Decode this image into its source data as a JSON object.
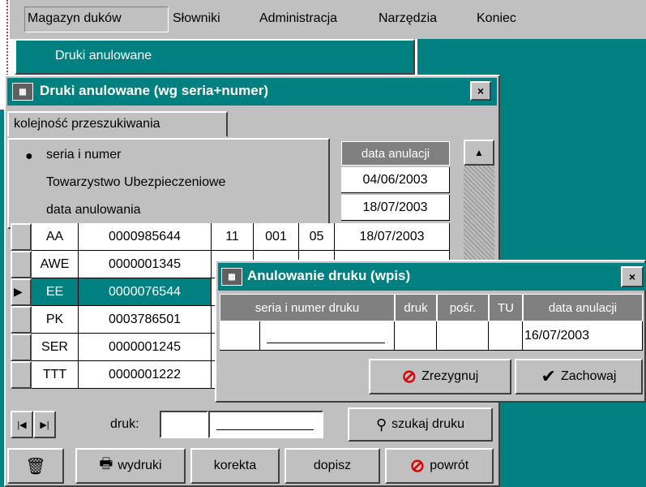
{
  "menu": {
    "items": [
      {
        "label": "Magazyn duków"
      },
      {
        "label": "Słowniki"
      },
      {
        "label": "Administracja"
      },
      {
        "label": "Narzędzia"
      },
      {
        "label": "Koniec"
      }
    ],
    "submenu_item": "Druki anulowane"
  },
  "main_window": {
    "title": "Druki anulowane (wg seria+numer)",
    "close": "×",
    "tab_label": "kolejność przeszukiwania",
    "sort_options": [
      {
        "label": "seria i numer",
        "selected": true
      },
      {
        "label": "Towarzystwo Ubezpieczeniowe",
        "selected": false
      },
      {
        "label": "data anulowania",
        "selected": false
      }
    ],
    "date_header": "data anulacji",
    "top_dates": [
      "04/06/2003",
      "18/07/2003"
    ],
    "rows": [
      {
        "seria": "AA",
        "numer": "0000985644",
        "c1": "11",
        "c2": "001",
        "c3": "05",
        "date": "18/07/2003",
        "current": false
      },
      {
        "seria": "AWE",
        "numer": "0000001345",
        "c1": "",
        "c2": "",
        "c3": "",
        "date": "",
        "current": false
      },
      {
        "seria": "EE",
        "numer": "0000076544",
        "c1": "",
        "c2": "",
        "c3": "",
        "date": "",
        "current": true
      },
      {
        "seria": "PK",
        "numer": "0003786501",
        "c1": "",
        "c2": "",
        "c3": "",
        "date": "",
        "current": false
      },
      {
        "seria": "SER",
        "numer": "0000001245",
        "c1": "",
        "c2": "",
        "c3": "",
        "date": "",
        "current": false
      },
      {
        "seria": "TTT",
        "numer": "0000001222",
        "c1": "",
        "c2": "",
        "c3": "",
        "date": "",
        "current": false
      }
    ],
    "druk_label": "druk:",
    "search_button": "szukaj druku",
    "print_button": "wydruki",
    "correct_button": "korekta",
    "add_button": "dopisz",
    "back_button": "powrót"
  },
  "dialog": {
    "title": "Anulowanie druku (wpis)",
    "close": "×",
    "headers": [
      "seria i numer druku",
      "druk",
      "pośr.",
      "TU",
      "data anulacji"
    ],
    "date_value": "16/07/2003",
    "cancel_button": "Zrezygnuj",
    "save_button": "Zachowaj"
  },
  "colors": {
    "desktop": "#008080",
    "title_bar": "#008080",
    "window": "#c0c0c0",
    "header": "#808080",
    "error": "#e00000"
  }
}
